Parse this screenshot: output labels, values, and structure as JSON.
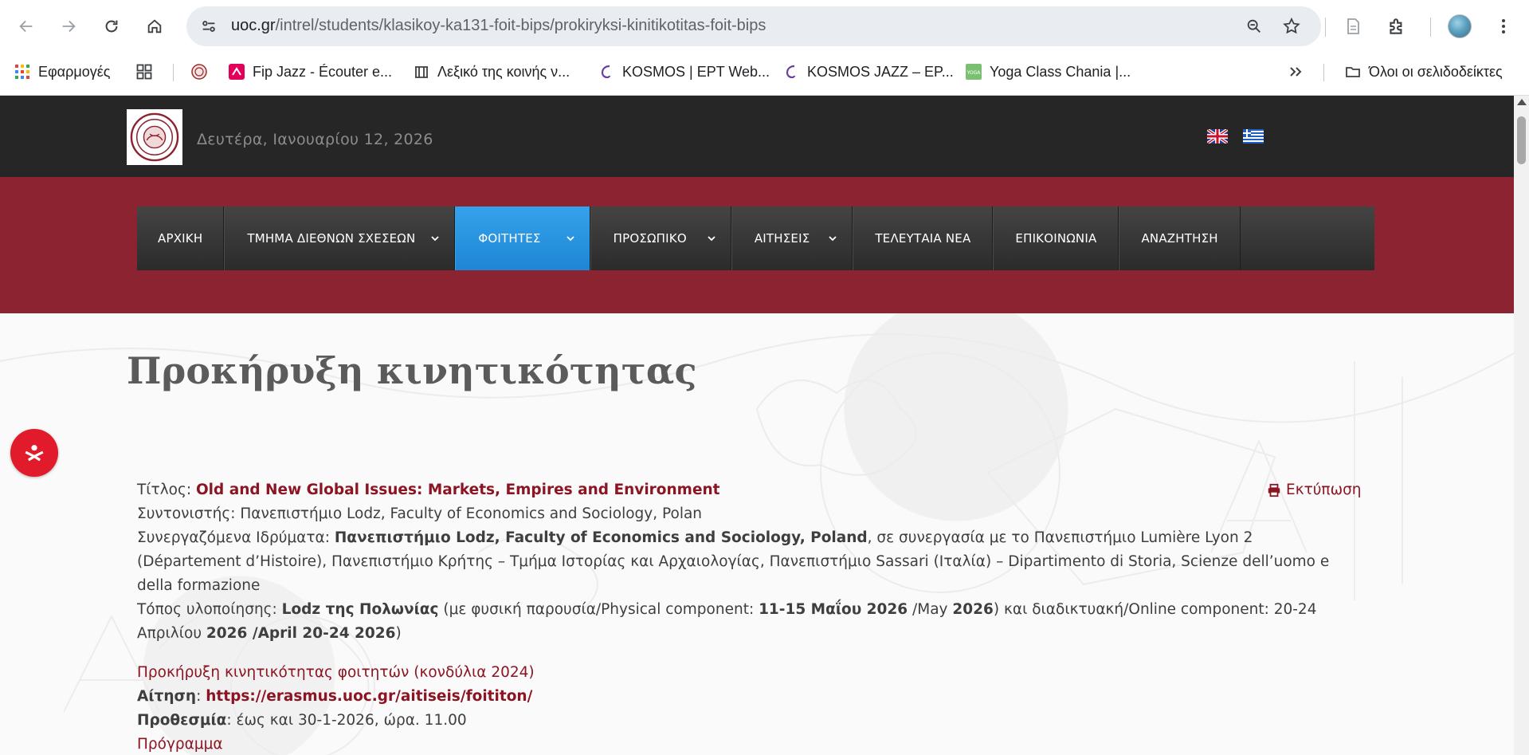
{
  "browser": {
    "url_host": "uoc.gr",
    "url_path": "/intrel/students/klasikoy-ka131-foit-bips/prokiryksi-kinitikotitas-foit-bips",
    "bookmarks": [
      {
        "label": "Εφαρμογές",
        "icon": "apps-grid-icon"
      },
      {
        "label": "",
        "icon": "grid-icon"
      },
      {
        "label": "",
        "icon": "uoc-seal-icon"
      },
      {
        "label": "Fip Jazz - Écouter e...",
        "icon": "fip-icon"
      },
      {
        "label": "Λεξικό της κοινής ν...",
        "icon": "lexicon-icon"
      },
      {
        "label": "KOSMOS | ΕΡΤ Web...",
        "icon": "kosmos-icon"
      },
      {
        "label": "KOSMOS JAZZ – EP...",
        "icon": "kosmos-icon"
      },
      {
        "label": "Yoga Class Chania |...",
        "icon": "yoga-icon"
      }
    ],
    "all_bookmarks_label": "Όλοι οι σελιδοδείκτες"
  },
  "site": {
    "date": "Δευτέρα, Ιανουαρίου 12, 2026",
    "menu": [
      {
        "label": "ΑΡΧΙΚΗ",
        "dropdown": false,
        "active": false
      },
      {
        "label": "ΤΜΗΜΑ ΔΙΕΘΝΩΝ ΣΧΕΣΕΩΝ",
        "dropdown": true,
        "active": false
      },
      {
        "label": "ΦΟΙΤΗΤΕΣ",
        "dropdown": true,
        "active": true
      },
      {
        "label": "ΠΡΟΣΩΠΙΚΟ",
        "dropdown": true,
        "active": false
      },
      {
        "label": "ΑΙΤΗΣΕΙΣ",
        "dropdown": true,
        "active": false
      },
      {
        "label": "ΤΕΛΕΥΤΑΙΑ ΝΕΑ",
        "dropdown": false,
        "active": false
      },
      {
        "label": "ΕΠΙΚΟΙΝΩΝΙΑ",
        "dropdown": false,
        "active": false
      },
      {
        "label": "ΑΝΑΖΗΤΗΣΗ",
        "dropdown": false,
        "active": false
      }
    ],
    "colors": {
      "topbar": "#262626",
      "band": "#8b2330",
      "active_menu": "#2a95e0",
      "link": "#8b1522"
    }
  },
  "article": {
    "title": "Προκήρυξη κινητικότητας",
    "print_label": "Εκτύπωση",
    "title_label": "Τίτλος:",
    "title_value": "Old and New Global Issues: Markets, Empires and Environment",
    "coordinator_label": "Συντονιστής:",
    "coordinator_value": "Πανεπιστήμιο Lodz, Faculty of Economics and Sociology, Polan",
    "partners_label": "Συνεργαζόμενα Ιδρύματα:",
    "partners_bold": "Πανεπιστήμιο Lodz, Faculty of Economics and Sociology, Poland",
    "partners_rest_1": ", σε συνεργασία με το Πανεπιστήμιο Lumière Lyon 2",
    "partners_rest_2": "(Département d’Histoire), Πανεπιστήμιο Κρήτης – Τμήμα Ιστορίας και Αρχαιολογίας, Πανεπιστήμιο Sassari (Ιταλία) – Dipartimento di Storia, Scienze dell’uomo e",
    "partners_rest_3": "della formazione",
    "place_label": "Τόπος υλοποίησης:",
    "place_bold": "Lodz της Πολωνίας",
    "place_t1": " (με φυσική παρουσία/Physical component: ",
    "place_b2": "11-15 Μαΐου 2026",
    "place_t3": " /May ",
    "place_b4": "2026",
    "place_t5": ") και διαδικτυακή/Online component: 20-24",
    "place_t6": "Απριλίου ",
    "place_b7": "2026 /April 20-24 2026",
    "place_t8": ")",
    "call_link": "Προκήρυξη κινητικότητας φοιτητών (κονδύλια 2024)",
    "application_label": "Αίτηση",
    "application_link": "https://erasmus.uoc.gr/aitiseis/foititon/",
    "deadline_label": "Προθεσμία",
    "deadline_value": ": έως και 30-1-2026, ώρα. 11.00",
    "program_link": "Πρόγραμμα"
  }
}
